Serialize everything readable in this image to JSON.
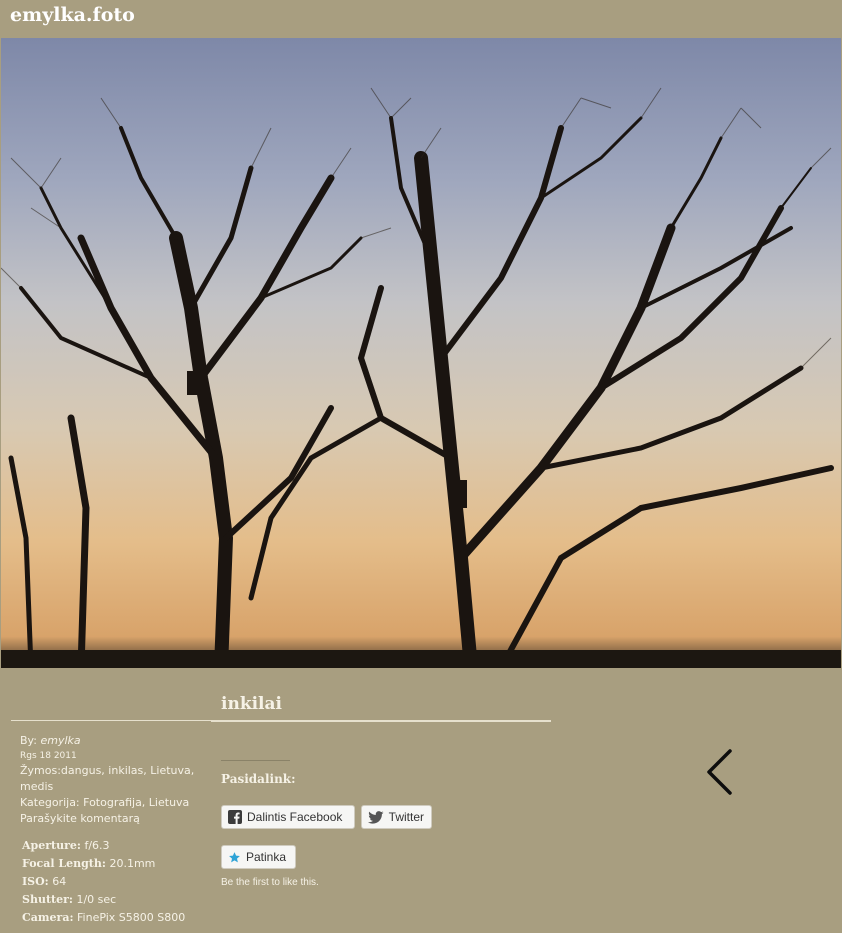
{
  "site": {
    "title": "emylka.foto"
  },
  "post": {
    "title": "inkilai"
  },
  "meta": {
    "by_label": "By:",
    "author": "emylka",
    "date": "Rgs 18 2011",
    "tags": "Žymos:dangus, inkilas, Lietuva, medis",
    "category": "Kategorija: Fotografija, Lietuva",
    "comment_link": "Parašykite komentarą"
  },
  "exif": [
    {
      "label": "Aperture:",
      "value": "f/6.3"
    },
    {
      "label": "Focal Length:",
      "value": "20.1mm"
    },
    {
      "label": "ISO:",
      "value": "64"
    },
    {
      "label": "Shutter:",
      "value": "1/0 sec"
    },
    {
      "label": "Camera:",
      "value": "FinePix S5800 S800"
    }
  ],
  "share": {
    "label": "Pasidalink:",
    "facebook_label": "Dalintis Facebook",
    "twitter_label": "Twitter",
    "like_label": "Patinka",
    "like_note": "Be the first to like this."
  },
  "icons": {
    "facebook": "facebook-icon",
    "twitter": "twitter-icon",
    "like": "star-icon",
    "prev": "chevron-left-icon"
  },
  "colors": {
    "background": "#a89e80",
    "text": "#f6f2e6",
    "like_star": "#2ea3d6"
  }
}
